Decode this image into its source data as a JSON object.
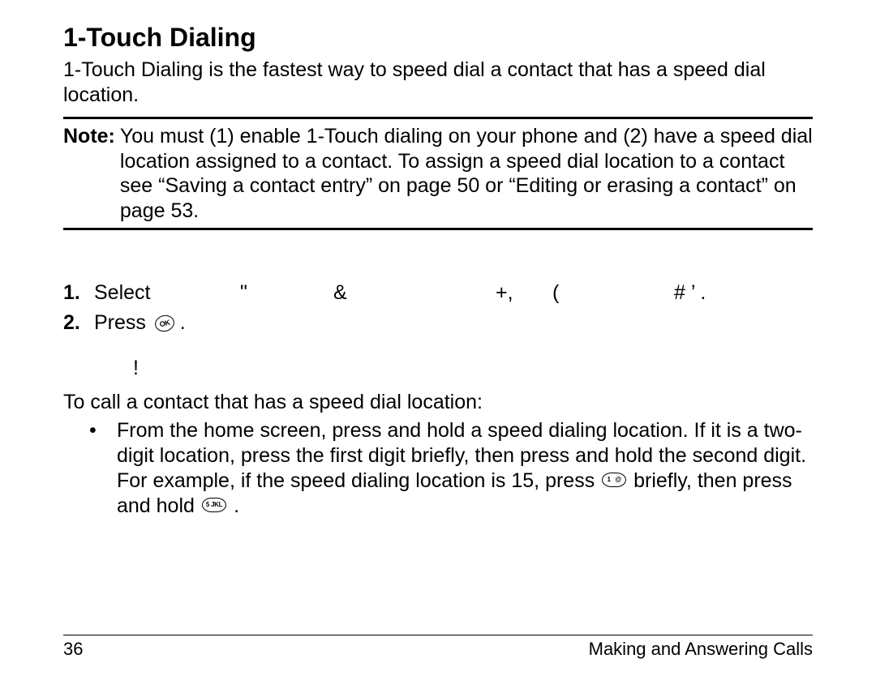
{
  "heading": "1-Touch Dialing",
  "intro": "1-Touch Dialing is the fastest way to speed dial a contact that has a speed dial location.",
  "note": {
    "label": "Note:",
    "body": "You must (1) enable 1-Touch dialing on your phone and (2) have a speed dial location assigned to a contact. To assign a speed dial location to a contact see “Saving a contact entry” on page 50 or “Editing or erasing a contact” on page 53."
  },
  "steps": {
    "one_num": "1.",
    "one_select": "Select",
    "one_sym1": "\"",
    "one_sym2": "&",
    "one_sym3": "+,",
    "one_sym4": "(",
    "one_sym5": "#  ’      .",
    "two_num": "2.",
    "two_text": "Press"
  },
  "stray": "!",
  "call_intro": "To call a contact that has a speed dial location:",
  "bullet": {
    "dot": "•",
    "part1": "From the home screen, press and hold a speed dialing location. If it is a two-digit location, press the first digit briefly, then press and hold the second digit. For example, if the speed dialing location is 15, press ",
    "key1": "1   @",
    "part2": " briefly, then press and hold ",
    "key2": "5 JKL",
    "part3": " ."
  },
  "footer": {
    "page": "36",
    "section": "Making and Answering Calls"
  }
}
